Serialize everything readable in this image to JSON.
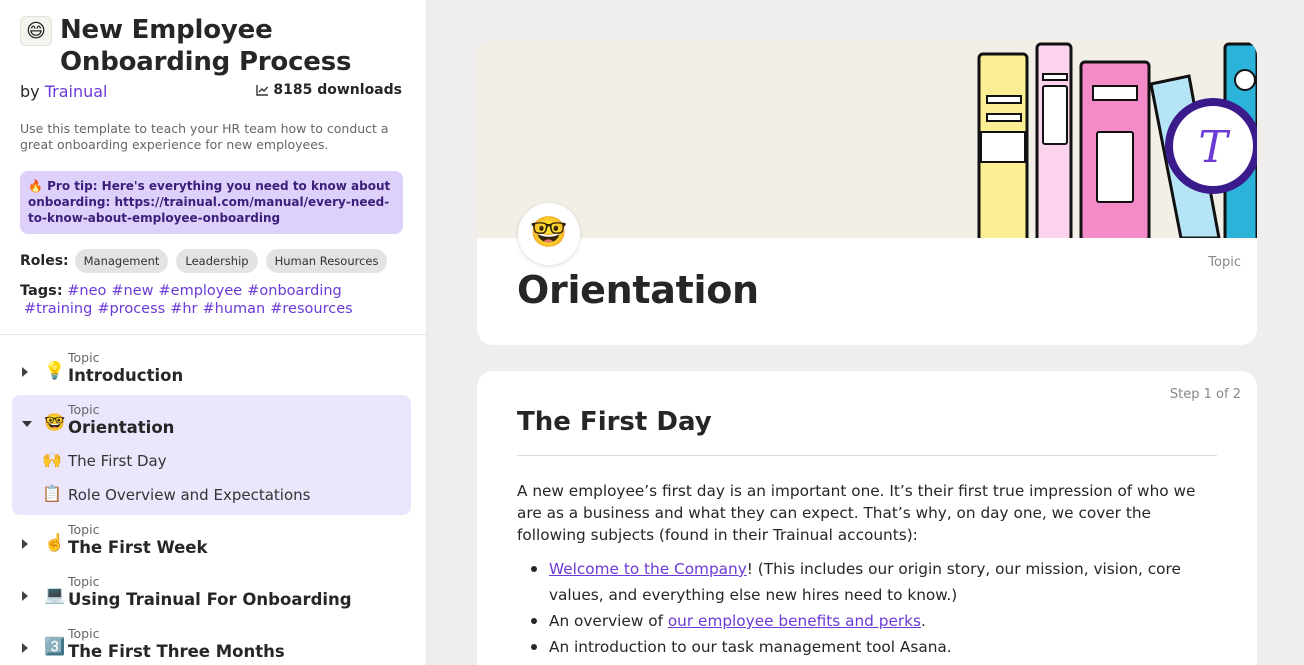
{
  "sidebar": {
    "title_emoji": "😄",
    "title": "New Employee Onboarding Process",
    "by_prefix": "by",
    "author": "Trainual",
    "downloads": "8185 downloads",
    "description": "Use this template to teach your HR team how to conduct a great onboarding experience for new employees.",
    "protip": "🔥 Pro tip: Here's everything you need to know about onboarding: https://trainual.com/manual/every-need-to-know-about-employee-onboarding",
    "roles_label": "Roles:",
    "roles": [
      "Management",
      "Leadership",
      "Human Resources"
    ],
    "tags_label": "Tags:",
    "tags": [
      "#neo",
      "#new",
      "#employee",
      "#onboarding",
      "#training",
      "#process",
      "#hr",
      "#human",
      "#resources"
    ],
    "topics": [
      {
        "emoji": "💡",
        "label": "Topic",
        "name": "Introduction"
      },
      {
        "emoji": "🤓",
        "label": "Topic",
        "name": "Orientation"
      },
      {
        "emoji": "☝️",
        "label": "Topic",
        "name": "The First Week"
      },
      {
        "emoji": "💻",
        "label": "Topic",
        "name": "Using Trainual For Onboarding"
      },
      {
        "emoji": "3️⃣",
        "label": "Topic",
        "name": "The First Three Months"
      }
    ],
    "steps": [
      {
        "emoji": "🙌",
        "name": "The First Day"
      },
      {
        "emoji": "📋",
        "name": "Role Overview and Expectations"
      }
    ]
  },
  "hero": {
    "emoji": "🤓",
    "label": "Topic",
    "title": "Orientation"
  },
  "content": {
    "step_label": "Step 1 of 2",
    "title": "The First Day",
    "paragraph": "A new employee’s first day is an important one. It’s their first true impression of who we are as a business and what they can expect. That’s why, on day one, we cover the following subjects (found in their Trainual accounts):",
    "bullets": [
      {
        "link": "Welcome to the Company",
        "text": "! (This includes our origin story, our mission, vision, core values, and everything else new hires need to know.)"
      },
      {
        "prefix": "An overview of ",
        "link": "our employee benefits and perks",
        "text": "."
      },
      {
        "text": "An introduction to our task management tool Asana."
      }
    ]
  },
  "colors": {
    "accent": "#6c3ad7",
    "active_bg": "#ece6fd",
    "protip_bg": "#ddd0fb",
    "page_bg": "#efeeed"
  }
}
